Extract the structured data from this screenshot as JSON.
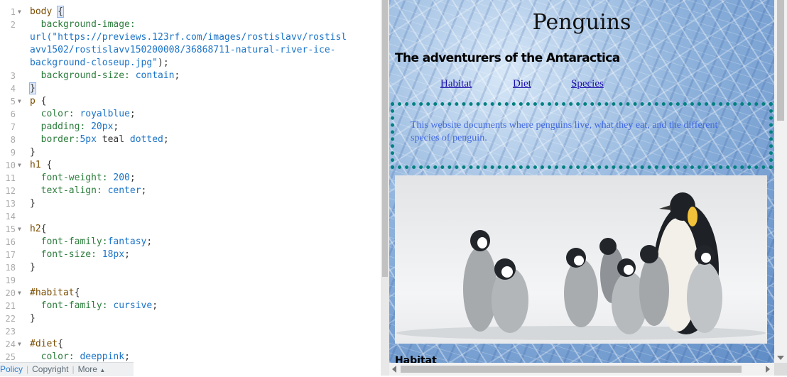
{
  "editor": {
    "lines": [
      {
        "n": "1",
        "fold": true,
        "parts": [
          [
            "sel",
            "body "
          ],
          [
            "cursor",
            "{"
          ]
        ]
      },
      {
        "n": "2",
        "fold": false,
        "parts": [
          [
            "prop",
            "  background-image:"
          ]
        ]
      },
      {
        "n": "",
        "fold": false,
        "parts": [
          [
            "val",
            "url(\"https://previews.123rf.com/images/rostislavv/rostisl"
          ]
        ]
      },
      {
        "n": "",
        "fold": false,
        "parts": [
          [
            "val",
            "avv1502/rostislavv150200008/36868711-natural-river-ice-"
          ]
        ]
      },
      {
        "n": "",
        "fold": false,
        "parts": [
          [
            "val",
            "background-closeup.jpg\""
          ],
          [
            "plain",
            ");"
          ]
        ]
      },
      {
        "n": "3",
        "fold": false,
        "parts": [
          [
            "prop",
            "  background-size: "
          ],
          [
            "val",
            "contain"
          ],
          [
            "plain",
            ";"
          ]
        ]
      },
      {
        "n": "4",
        "fold": false,
        "parts": [
          [
            "cursor",
            "}"
          ]
        ]
      },
      {
        "n": "5",
        "fold": true,
        "parts": [
          [
            "sel",
            "p "
          ],
          [
            "plain",
            "{"
          ]
        ]
      },
      {
        "n": "6",
        "fold": false,
        "parts": [
          [
            "prop",
            "  color: "
          ],
          [
            "val",
            "royalblue"
          ],
          [
            "plain",
            ";"
          ]
        ]
      },
      {
        "n": "7",
        "fold": false,
        "parts": [
          [
            "prop",
            "  padding: "
          ],
          [
            "val",
            "20px"
          ],
          [
            "plain",
            ";"
          ]
        ]
      },
      {
        "n": "8",
        "fold": false,
        "parts": [
          [
            "prop",
            "  border:"
          ],
          [
            "val",
            "5px "
          ],
          [
            "plain",
            "teal "
          ],
          [
            "val",
            "dotted"
          ],
          [
            "plain",
            ";"
          ]
        ]
      },
      {
        "n": "9",
        "fold": false,
        "parts": [
          [
            "plain",
            "}"
          ]
        ]
      },
      {
        "n": "10",
        "fold": true,
        "parts": [
          [
            "sel",
            "h1 "
          ],
          [
            "plain",
            "{"
          ]
        ]
      },
      {
        "n": "11",
        "fold": false,
        "parts": [
          [
            "prop",
            "  font-weight: "
          ],
          [
            "val",
            "200"
          ],
          [
            "plain",
            ";"
          ]
        ]
      },
      {
        "n": "12",
        "fold": false,
        "parts": [
          [
            "prop",
            "  text-align: "
          ],
          [
            "val",
            "center"
          ],
          [
            "plain",
            ";"
          ]
        ]
      },
      {
        "n": "13",
        "fold": false,
        "parts": [
          [
            "plain",
            "}"
          ]
        ]
      },
      {
        "n": "14",
        "fold": false,
        "parts": []
      },
      {
        "n": "15",
        "fold": true,
        "parts": [
          [
            "sel",
            "h2"
          ],
          [
            "plain",
            "{"
          ]
        ]
      },
      {
        "n": "16",
        "fold": false,
        "parts": [
          [
            "prop",
            "  font-family:"
          ],
          [
            "val",
            "fantasy"
          ],
          [
            "plain",
            ";"
          ]
        ]
      },
      {
        "n": "17",
        "fold": false,
        "parts": [
          [
            "prop",
            "  font-size: "
          ],
          [
            "val",
            "18px"
          ],
          [
            "plain",
            ";"
          ]
        ]
      },
      {
        "n": "18",
        "fold": false,
        "parts": [
          [
            "plain",
            "}"
          ]
        ]
      },
      {
        "n": "19",
        "fold": false,
        "parts": []
      },
      {
        "n": "20",
        "fold": true,
        "parts": [
          [
            "sel",
            "#habitat"
          ],
          [
            "plain",
            "{"
          ]
        ]
      },
      {
        "n": "21",
        "fold": false,
        "parts": [
          [
            "prop",
            "  font-family: "
          ],
          [
            "val",
            "cursive"
          ],
          [
            "plain",
            ";"
          ]
        ]
      },
      {
        "n": "22",
        "fold": false,
        "parts": [
          [
            "plain",
            "}"
          ]
        ]
      },
      {
        "n": "23",
        "fold": false,
        "parts": []
      },
      {
        "n": "24",
        "fold": true,
        "parts": [
          [
            "sel",
            "#diet"
          ],
          [
            "plain",
            "{"
          ]
        ]
      },
      {
        "n": "25",
        "fold": false,
        "parts": [
          [
            "prop",
            "  color: "
          ],
          [
            "val",
            "deeppink"
          ],
          [
            "plain",
            ";"
          ]
        ]
      }
    ]
  },
  "footer": {
    "policy": "Policy",
    "copyright": "Copyright",
    "more": "More",
    "sep": "|"
  },
  "preview": {
    "title": "Penguins",
    "subtitle": "The adventurers of the Antaractica",
    "links": {
      "habitat": "Habitat",
      "diet": "Diet",
      "species": "Species"
    },
    "paragraph": "This website documents where penguins live, what they eat, and the different species of penguin.",
    "next_heading": "Habitat"
  },
  "colors": {
    "paragraph_text": "#4169e1",
    "border": "#008080"
  }
}
